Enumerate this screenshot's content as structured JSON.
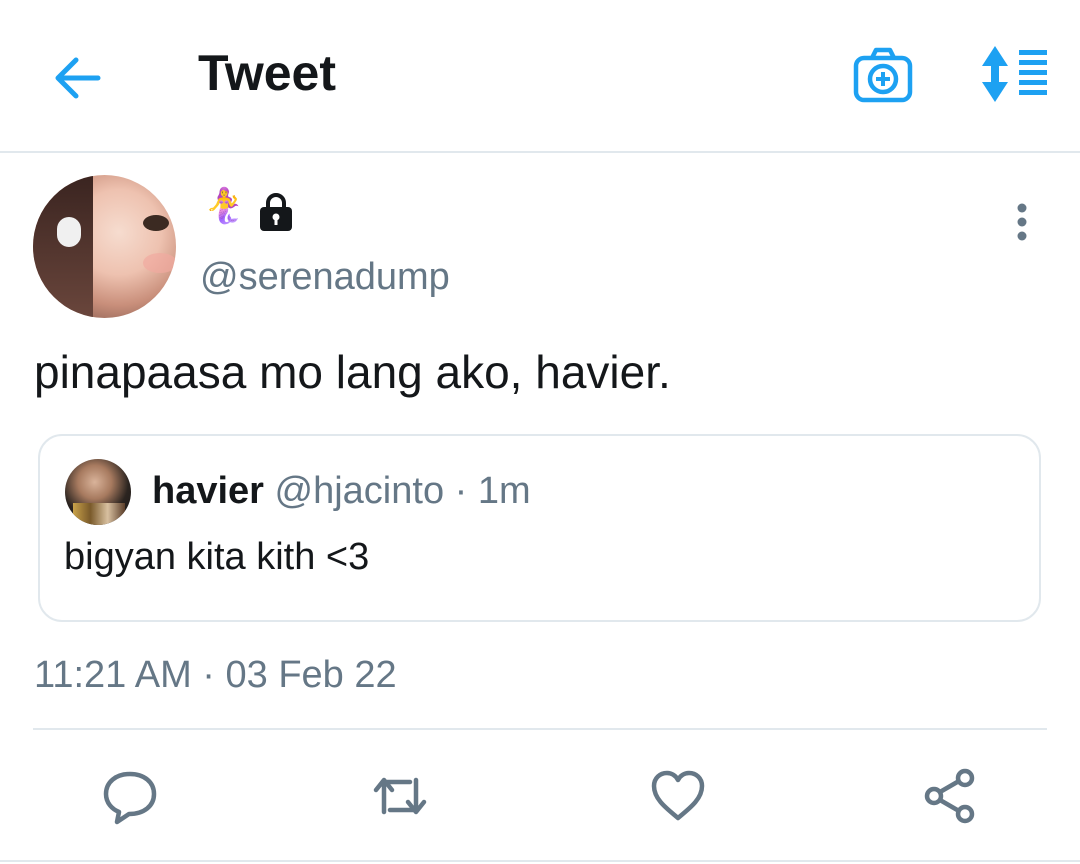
{
  "header": {
    "title": "Tweet",
    "back_icon": "arrow-left-icon",
    "camera_icon": "camera-plus-icon",
    "sort_icon": "sort-list-icon",
    "accent": "#1da1f2"
  },
  "tweet": {
    "name_emoji": "🧜‍♀️",
    "protected_icon": "lock-icon",
    "handle": "@serenadump",
    "text": "pinapaasa mo lang ako, havier.",
    "more_icon": "more-vertical-icon",
    "timestamp": "11:21 AM · 03 Feb 22"
  },
  "quote": {
    "name": "havier",
    "meta": " @hjacinto · 1m",
    "text": "bigyan kita kith <3"
  },
  "actions": [
    {
      "icon": "reply-icon"
    },
    {
      "icon": "retweet-icon"
    },
    {
      "icon": "like-icon"
    },
    {
      "icon": "share-icon"
    }
  ],
  "colors": {
    "text_primary": "#14171a",
    "text_secondary": "#657786",
    "divider": "#e1e8ed",
    "icon_gray": "#657786"
  }
}
